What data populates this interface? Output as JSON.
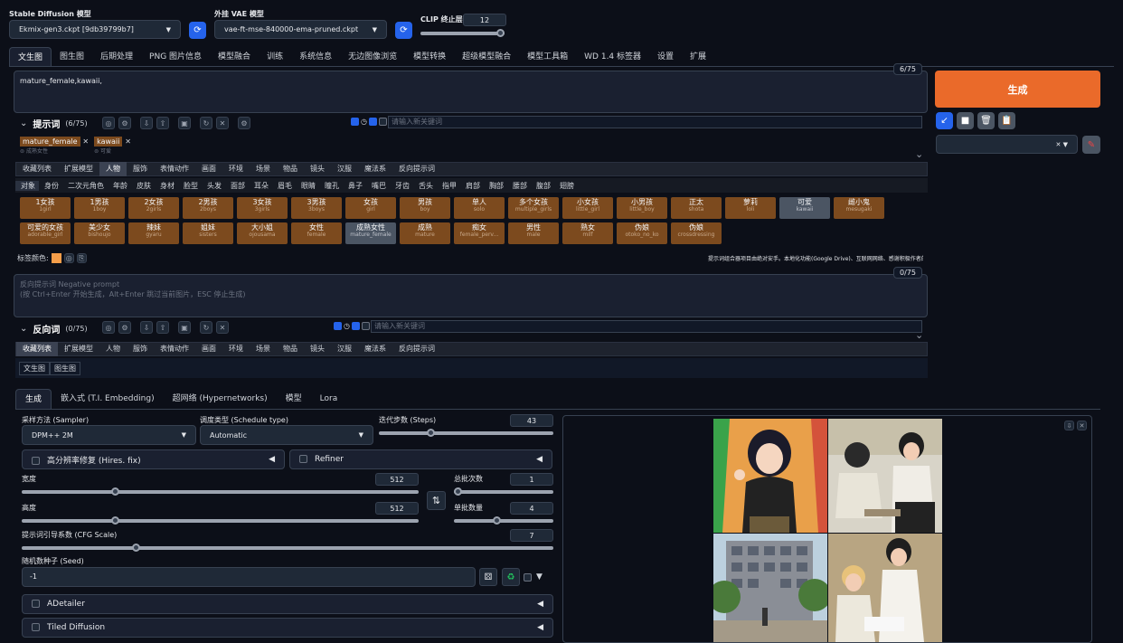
{
  "header": {
    "sd_model_label": "Stable Diffusion 模型",
    "sd_model_value": "Ekmix-gen3.ckpt [9db39799b7]",
    "vae_label": "外挂 VAE 模型",
    "vae_value": "vae-ft-mse-840000-ema-pruned.ckpt",
    "clip_label": "CLIP 终止层数",
    "clip_value": "12",
    "clip_fraction": 1.0
  },
  "main_tabs": [
    "文生图",
    "图生图",
    "后期处理",
    "PNG 图片信息",
    "模型融合",
    "训练",
    "系统信息",
    "无边图像浏览",
    "模型转换",
    "超级模型融合",
    "模型工具箱",
    "WD 1.4 标签器",
    "设置",
    "扩展"
  ],
  "prompt": {
    "text": "mature_female,kawaii,",
    "counter": "6/75",
    "section_label": "提示词",
    "section_count": "(6/75)",
    "keyword_placeholder": "请输入新关键词",
    "tags": [
      {
        "en": "mature_female",
        "zh": "成熟女性"
      },
      {
        "en": "kawaii",
        "zh": "可爱"
      }
    ]
  },
  "generate_label": "生成",
  "categories": [
    "收藏列表",
    "扩展模型",
    "人物",
    "服饰",
    "表情动作",
    "画面",
    "环境",
    "场景",
    "物品",
    "镜头",
    "汉服",
    "魔法系",
    "反向提示词"
  ],
  "categories_active_index": 2,
  "subcategories": [
    "对象",
    "身份",
    "二次元角色",
    "年龄",
    "皮肤",
    "身材",
    "脸型",
    "头发",
    "面部",
    "耳朵",
    "眉毛",
    "眼睛",
    "瞳孔",
    "鼻子",
    "嘴巴",
    "牙齿",
    "舌头",
    "指甲",
    "肩部",
    "胸部",
    "腰部",
    "腹部",
    "翅膀"
  ],
  "chips": [
    {
      "z": "1女孩",
      "e": "1girl",
      "gray": false
    },
    {
      "z": "1男孩",
      "e": "1boy",
      "gray": false
    },
    {
      "z": "2女孩",
      "e": "2girls",
      "gray": false
    },
    {
      "z": "2男孩",
      "e": "2boys",
      "gray": false
    },
    {
      "z": "3女孩",
      "e": "3girls",
      "gray": false
    },
    {
      "z": "3男孩",
      "e": "3boys",
      "gray": false
    },
    {
      "z": "女孩",
      "e": "girl",
      "gray": false
    },
    {
      "z": "男孩",
      "e": "boy",
      "gray": false
    },
    {
      "z": "单人",
      "e": "solo",
      "gray": false
    },
    {
      "z": "多个女孩",
      "e": "multiple_girls",
      "gray": false
    },
    {
      "z": "小女孩",
      "e": "little_girl",
      "gray": false
    },
    {
      "z": "小男孩",
      "e": "little_boy",
      "gray": false
    },
    {
      "z": "正太",
      "e": "shota",
      "gray": false
    },
    {
      "z": "萝莉",
      "e": "loli",
      "gray": false
    },
    {
      "z": "可爱",
      "e": "kawaii",
      "gray": true
    },
    {
      "z": "雌小鬼",
      "e": "mesugaki",
      "gray": false
    },
    {
      "z": "可爱的女孩",
      "e": "adorable_girl",
      "gray": false
    },
    {
      "z": "美少女",
      "e": "bishoujo",
      "gray": false
    },
    {
      "z": "辣妹",
      "e": "gyaru",
      "gray": false
    },
    {
      "z": "姐妹",
      "e": "sisters",
      "gray": false
    },
    {
      "z": "大小姐",
      "e": "ojousama",
      "gray": false
    },
    {
      "z": "女性",
      "e": "female",
      "gray": false
    },
    {
      "z": "成熟女性",
      "e": "mature_female",
      "gray": true
    },
    {
      "z": "成熟",
      "e": "mature",
      "gray": false
    },
    {
      "z": "痴女",
      "e": "female_perv...",
      "gray": false
    },
    {
      "z": "男性",
      "e": "male",
      "gray": false
    },
    {
      "z": "熟女",
      "e": "milf",
      "gray": false
    },
    {
      "z": "伪娘",
      "e": "otoko_no_ko",
      "gray": false
    },
    {
      "z": "伪娘",
      "e": "crossdressing",
      "gray": false
    }
  ],
  "tag_color_label": "标签颜色:",
  "tip_text": "提示词组合器项目由绝对安手。本地化功能(Google Drive)、互联网网络、感谢积极作者的无私奉献!",
  "negative": {
    "placeholder": "反向提示词 Negative prompt\n(按 Ctrl+Enter 开始生成，Alt+Enter 跳过当前图片，ESC 停止生成)",
    "counter": "0/75",
    "section_label": "反向词",
    "section_count": "(0/75)",
    "keyword_placeholder": "请输入新关键词",
    "categories": [
      "收藏列表",
      "扩展模型",
      "人物",
      "服饰",
      "表情动作",
      "画面",
      "环境",
      "场景",
      "物品",
      "镜头",
      "汉服",
      "魔法系",
      "反向提示词"
    ],
    "subtabs": [
      "文生图",
      "图生图"
    ]
  },
  "gen_tabs": [
    "生成",
    "嵌入式 (T.I. Embedding)",
    "超网络 (Hypernetworks)",
    "模型",
    "Lora"
  ],
  "params": {
    "sampler_label": "采样方法 (Sampler)",
    "sampler_value": "DPM++ 2M",
    "schedule_label": "调度类型 (Schedule type)",
    "schedule_value": "Automatic",
    "steps_label": "迭代步数 (Steps)",
    "steps_value": "43",
    "steps_fraction": 0.29,
    "hires_label": "高分辨率修复 (Hires. fix)",
    "refiner_label": "Refiner",
    "width_label": "宽度",
    "width_value": "512",
    "width_fraction": 0.23,
    "height_label": "高度",
    "height_value": "512",
    "height_fraction": 0.23,
    "batch_count_label": "总批次数",
    "batch_count_value": "1",
    "batch_count_fraction": 0.0,
    "batch_size_label": "单批数量",
    "batch_size_value": "4",
    "batch_size_fraction": 0.43,
    "cfg_label": "提示词引导系数 (CFG Scale)",
    "cfg_value": "7",
    "cfg_fraction": 0.21,
    "seed_label": "随机数种子 (Seed)",
    "seed_value": "-1",
    "adetailer_label": "ADetailer",
    "tiled_label": "Tiled Diffusion"
  }
}
